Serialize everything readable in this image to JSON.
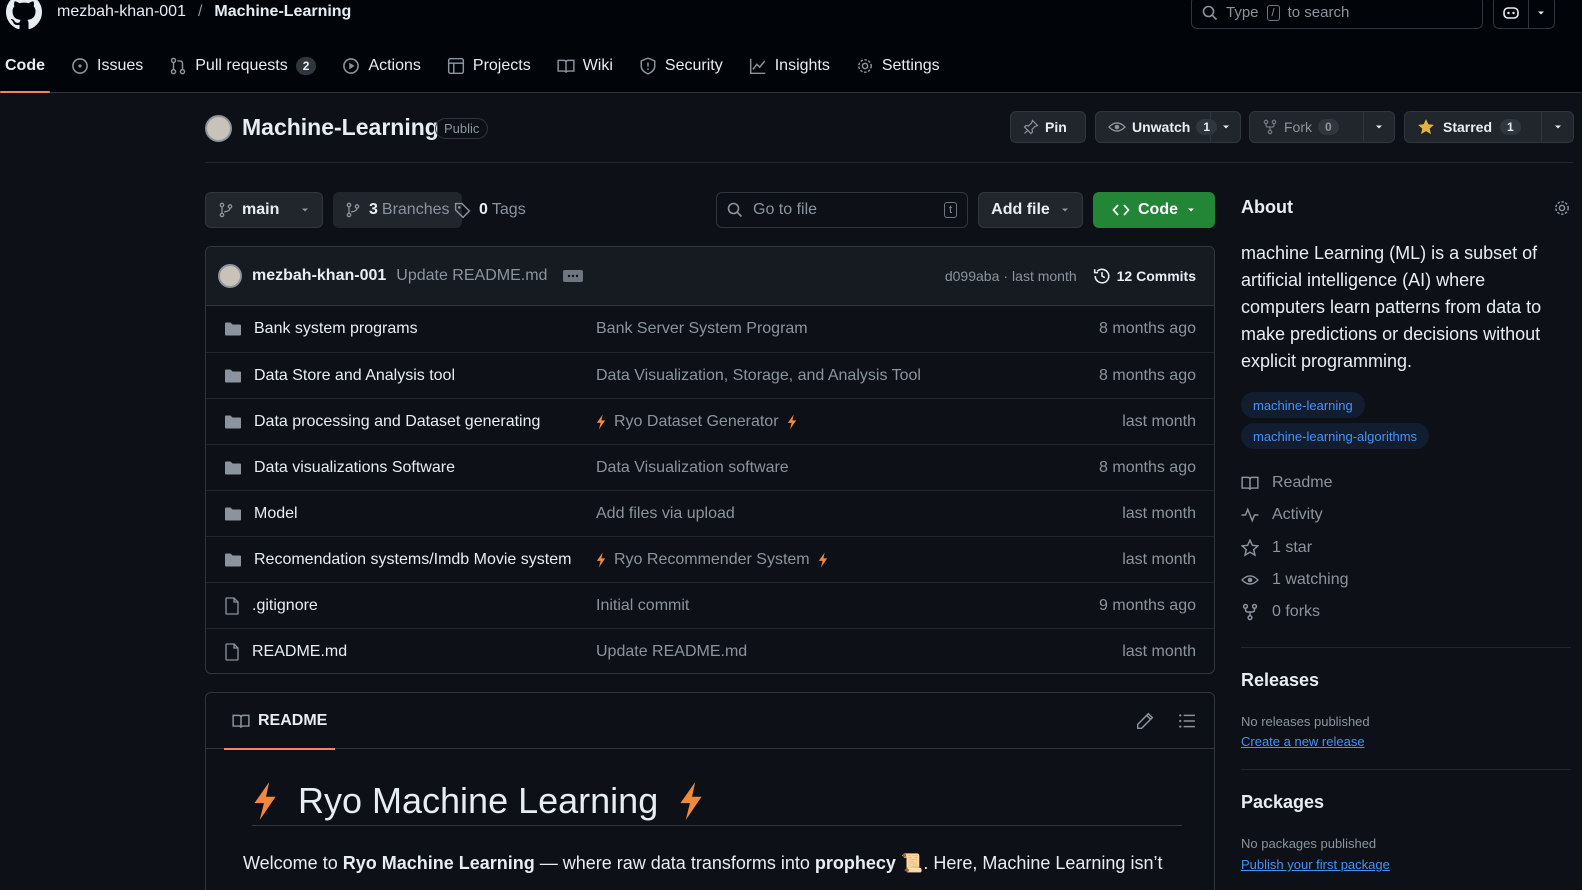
{
  "header": {
    "owner": "mezbah-khan-001",
    "separator": "/",
    "repo": "Machine-Learning",
    "search_prefix": "Type",
    "search_key": "/",
    "search_suffix": "to search"
  },
  "tabs": [
    {
      "label": "Code",
      "icon": "code-icon"
    },
    {
      "label": "Issues",
      "icon": "issue-icon"
    },
    {
      "label": "Pull requests",
      "icon": "pull-request-icon",
      "count": "2"
    },
    {
      "label": "Actions",
      "icon": "play-icon"
    },
    {
      "label": "Projects",
      "icon": "table-icon"
    },
    {
      "label": "Wiki",
      "icon": "book-icon"
    },
    {
      "label": "Security",
      "icon": "shield-icon"
    },
    {
      "label": "Insights",
      "icon": "graph-icon"
    },
    {
      "label": "Settings",
      "icon": "gear-icon"
    }
  ],
  "repo_header": {
    "title": "Machine-Learning",
    "visibility": "Public",
    "pin": "Pin",
    "unwatch": "Unwatch",
    "watch_count": "1",
    "fork": "Fork",
    "fork_count": "0",
    "starred": "Starred",
    "star_count": "1"
  },
  "branchbar": {
    "branch": "main",
    "branches_count": "3",
    "branches_label": "Branches",
    "tags_count": "0",
    "tags_label": "Tags",
    "goto_placeholder": "Go to file",
    "goto_key": "t",
    "add_file": "Add file",
    "code": "Code"
  },
  "latest_commit": {
    "author": "mezbah-khan-001",
    "message": "Update README.md",
    "hash": "d099aba",
    "dot": "·",
    "time": "last month",
    "commits": "12 Commits"
  },
  "files": [
    {
      "type": "dir",
      "name": "Bank system programs",
      "message": "Bank Server System Program",
      "time": "8 months ago",
      "bolts": false
    },
    {
      "type": "dir",
      "name": "Data Store and Analysis tool",
      "message": "Data Visualization, Storage, and Analysis Tool",
      "time": "8 months ago",
      "bolts": false
    },
    {
      "type": "dir",
      "name": "Data processing and Dataset generating",
      "message": "Ryo Dataset Generator",
      "time": "last month",
      "bolts": true
    },
    {
      "type": "dir",
      "name": "Data visualizations Software",
      "message": "Data Visualization software",
      "time": "8 months ago",
      "bolts": false
    },
    {
      "type": "dir",
      "name": "Model",
      "message": "Add files via upload",
      "time": "last month",
      "bolts": false
    },
    {
      "type": "dir",
      "name": "Recomendation systems/Imdb Movie system",
      "message": "Ryo Recommender System",
      "time": "last month",
      "bolts": true
    },
    {
      "type": "file",
      "name": ".gitignore",
      "message": "Initial commit",
      "time": "9 months ago",
      "bolts": false
    },
    {
      "type": "file",
      "name": "README.md",
      "message": "Update README.md",
      "time": "last month",
      "bolts": false
    }
  ],
  "readme": {
    "tab": "README",
    "heading": "Ryo Machine Learning",
    "p_start": "Welcome to ",
    "p_bold1": "Ryo Machine Learning",
    "p_mid": " — where raw data transforms into ",
    "p_bold2": "prophecy",
    "p_scroll": "📜",
    "p_end": ". Here, Machine Learning isn’t"
  },
  "about": {
    "title": "About",
    "description": "machine Learning (ML) is a subset of artificial intelligence (AI) where computers learn patterns from data to make predictions or decisions without explicit programming.",
    "topics": [
      "machine-learning",
      "machine-learning-algorithms"
    ],
    "readme": "Readme",
    "activity": "Activity",
    "stars": "1 star",
    "watching": "1 watching",
    "forks": "0 forks"
  },
  "releases": {
    "title": "Releases",
    "none": "No releases published",
    "create": "Create a new release"
  },
  "packages": {
    "title": "Packages",
    "none": "No packages published",
    "publish": "Publish your first package"
  },
  "colors": {
    "background": "#0d1117",
    "accent_tab": "#f78166",
    "code_button": "#238636",
    "link": "#4493f8",
    "bolt": "#f0883e"
  }
}
